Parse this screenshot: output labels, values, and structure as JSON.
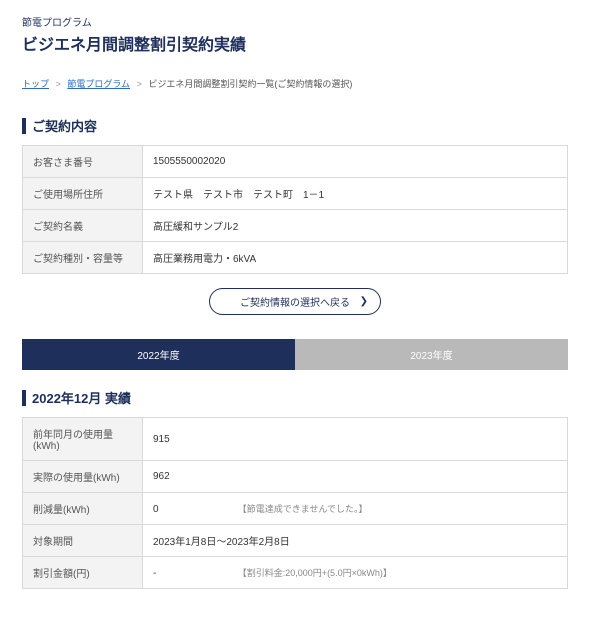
{
  "header": {
    "program": "節電プログラム",
    "title": "ビジエネ月間調整割引契約実績"
  },
  "breadcrumb": {
    "top": "トップ",
    "program": "節電プログラム",
    "current": "ビジエネ月間調整割引契約一覧(ご契約情報の選択)"
  },
  "contract": {
    "section_title": "ご契約内容",
    "rows": {
      "customer_no_label": "お客さま番号",
      "customer_no_value": "1505550002020",
      "address_label": "ご使用場所住所",
      "address_value": "テスト県　テスト市　テスト町　1－1",
      "name_label": "ご契約名義",
      "name_value": "高圧緩和サンプル2",
      "type_label": "ご契約種別・容量等",
      "type_value": "高圧業務用電力・6kVA"
    },
    "back_button": "ご契約情報の選択へ戻る"
  },
  "tabs": {
    "y2022": "2022年度",
    "y2023": "2023年度"
  },
  "results": {
    "section_title": "2022年12月  実績",
    "rows": {
      "prev_label": "前年同月の使用量(kWh)",
      "prev_value": "915",
      "actual_label": "実際の使用量(kWh)",
      "actual_value": "962",
      "reduction_label": "削減量(kWh)",
      "reduction_value": "0",
      "reduction_note": "【節電達成できませんでした。】",
      "period_label": "対象期間",
      "period_value": "2023年1月8日～2023年2月8日",
      "discount_label": "割引金額(円)",
      "discount_value": "-",
      "discount_note": "【割引料金:20,000円+(5.0円×0kWh)】"
    }
  }
}
